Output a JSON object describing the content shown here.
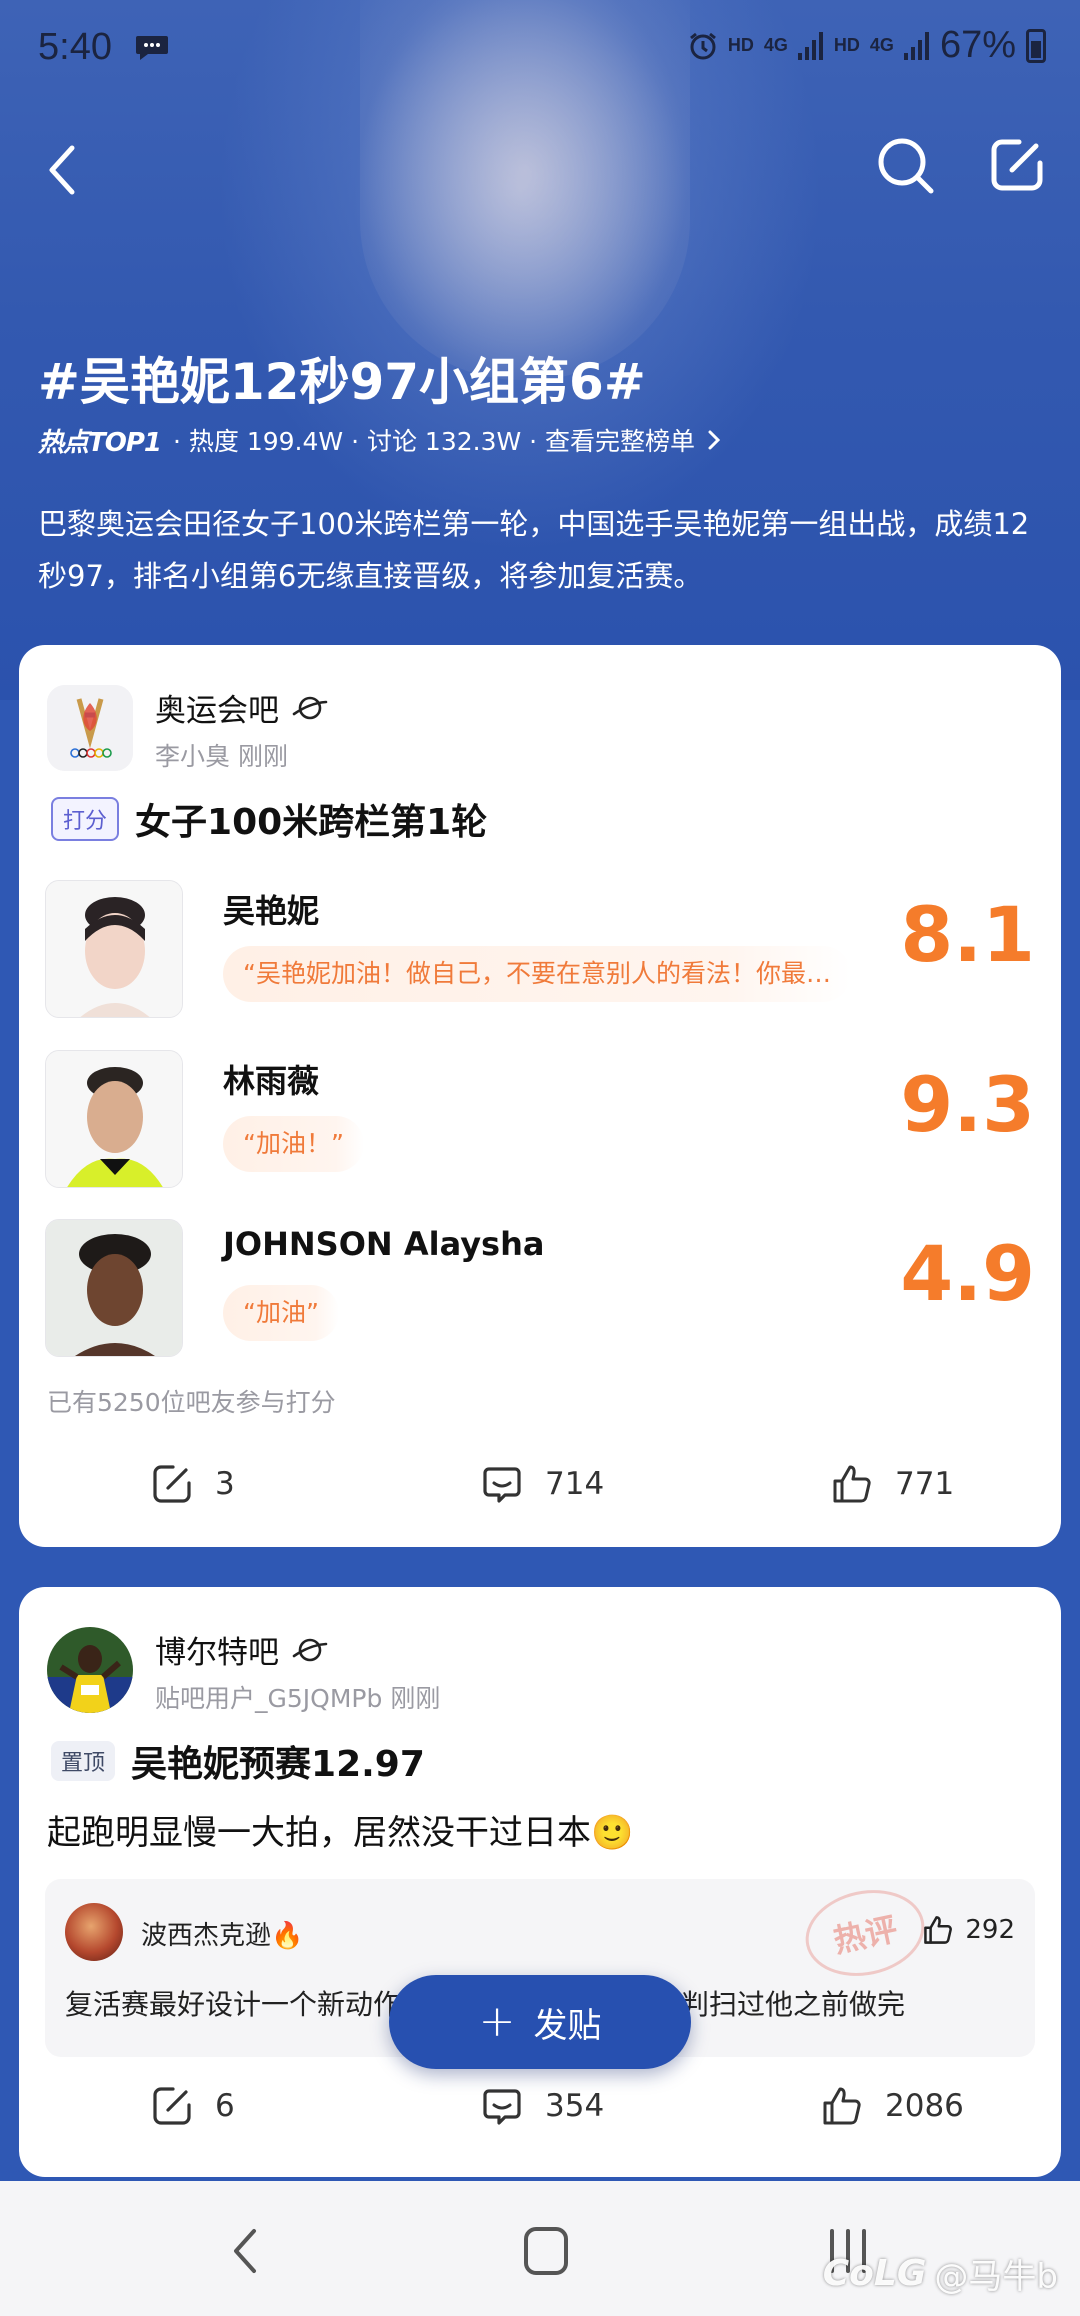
{
  "statusbar": {
    "time": "5:40",
    "net1": "HD",
    "net1_type": "4G",
    "net2": "HD",
    "net2_type": "4G",
    "battery": "67%"
  },
  "topic": {
    "title": "#吴艳妮12秒97小组第6#",
    "badge": "热点TOP1",
    "meta": "· 热度 199.4W · 讨论 132.3W · 查看完整榜单",
    "description": "巴黎奥运会田径女子100米跨栏第一轮，中国选手吴艳妮第一组出战，成绩12秒97，排名小组第6无缘直接晋级，将参加复活赛。"
  },
  "card1": {
    "bar_name": "奥运会吧",
    "user": "李小臭",
    "time": "刚刚",
    "badge": "打分",
    "title": "女子100米跨栏第1轮",
    "ratings": [
      {
        "name": "吴艳妮",
        "quote": "“吴艳妮加油！做自己，不要在意别人的看法！你最…",
        "score": "8.1"
      },
      {
        "name": "林雨薇",
        "quote": "“加油！”",
        "score": "9.3"
      },
      {
        "name": "JOHNSON Alaysha",
        "quote": "“加油”",
        "score": "4.9"
      }
    ],
    "participants": "已有5250位吧友参与打分",
    "actions": {
      "share": "3",
      "comments": "714",
      "likes": "771"
    }
  },
  "card2": {
    "bar_name": "博尔特吧",
    "user": "贴吧用户_G5JQMPb",
    "time": "刚刚",
    "badge": "置顶",
    "title": "吴艳妮预赛12.97",
    "body": "起跑明显慢一大拍，居然没干过日本🙂",
    "hot_comment": {
      "user": "波西杰克逊🔥",
      "text": "复活赛最好设计一个新动作，抢跑那种，争取在裁判扫过他之前做完",
      "stamp": "热评",
      "likes": "292"
    },
    "actions": {
      "share": "6",
      "comments": "354",
      "likes": "2086"
    }
  },
  "fab": {
    "label": "发贴"
  },
  "watermark": {
    "logo": "CoLG",
    "handle": "@马牛b"
  },
  "colors": {
    "brand_blue": "#2750b0",
    "score_orange": "#f57c2b",
    "background_blue": "#2f58b4"
  }
}
